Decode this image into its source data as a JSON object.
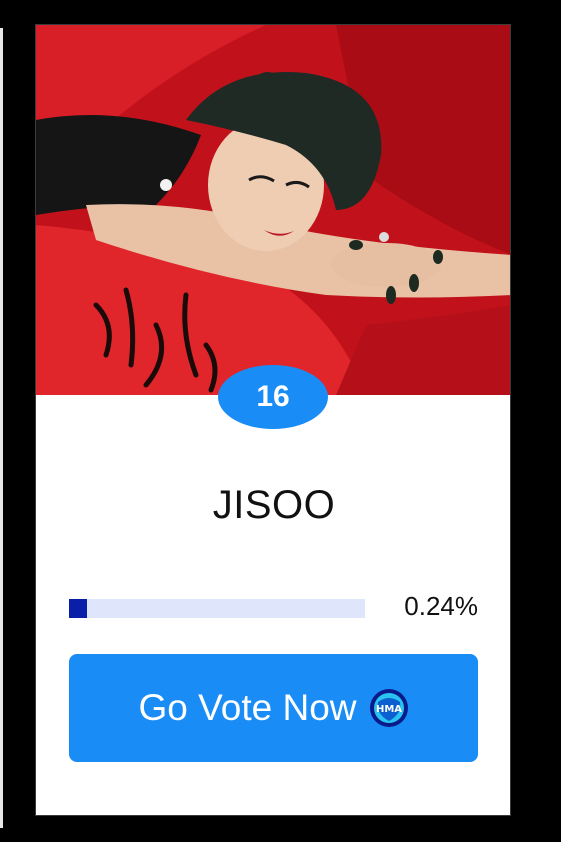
{
  "candidate": {
    "rank": "16",
    "name": "JISOO",
    "percent_label": "0.24%",
    "vote_share": 0.0024
  },
  "progress": {
    "visual_fill_fraction": 0.06
  },
  "vote_button": {
    "label": "Go Vote Now",
    "icon_text": "HMA"
  },
  "colors": {
    "accent": "#1a8cf5",
    "progress_fill": "#0b1ea8",
    "progress_track": "#dfe5fb",
    "photo_background": "#c1121b"
  },
  "icons": {
    "photo": "artist-photo",
    "vote": "hma-logo-icon"
  }
}
